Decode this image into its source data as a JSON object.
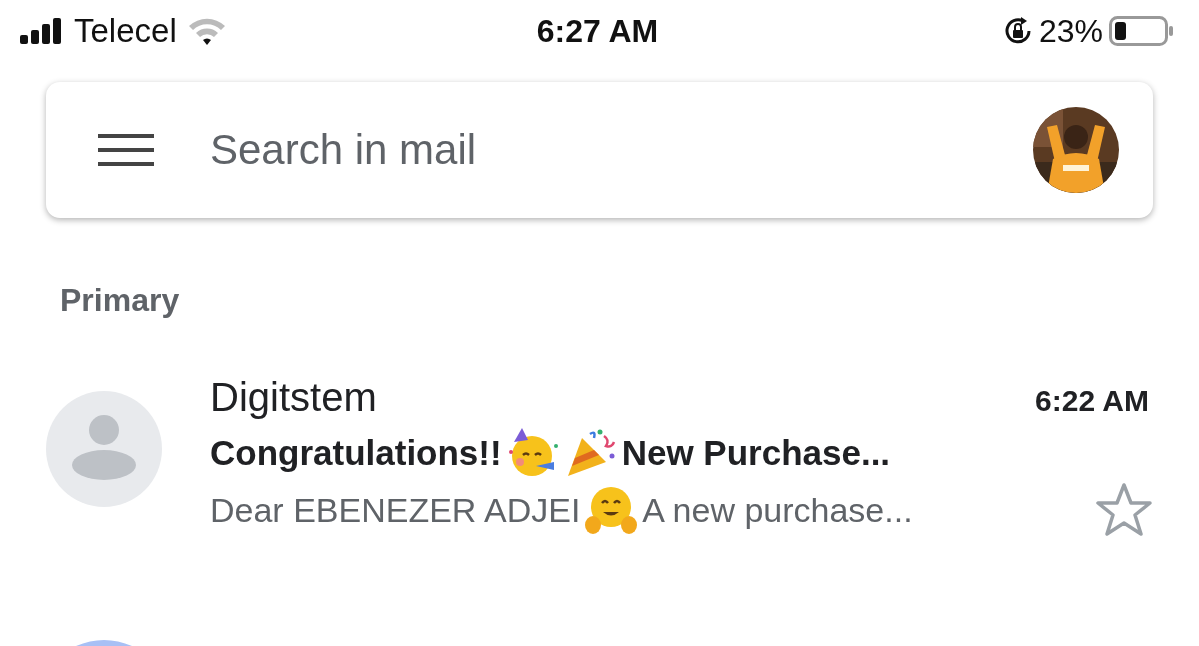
{
  "status_bar": {
    "carrier": "Telecel",
    "time": "6:27 AM",
    "battery": "23%"
  },
  "search": {
    "placeholder": "Search in mail"
  },
  "section": "Primary",
  "emails": [
    {
      "sender": "Digitstem",
      "time": "6:22 AM",
      "subject_start": "Congratulations!!",
      "subject_end": "New Purchase...",
      "snippet_start": "Dear EBENEZER ADJEI",
      "snippet_end": "A new purchase...",
      "unread": true,
      "starred": false
    }
  ]
}
